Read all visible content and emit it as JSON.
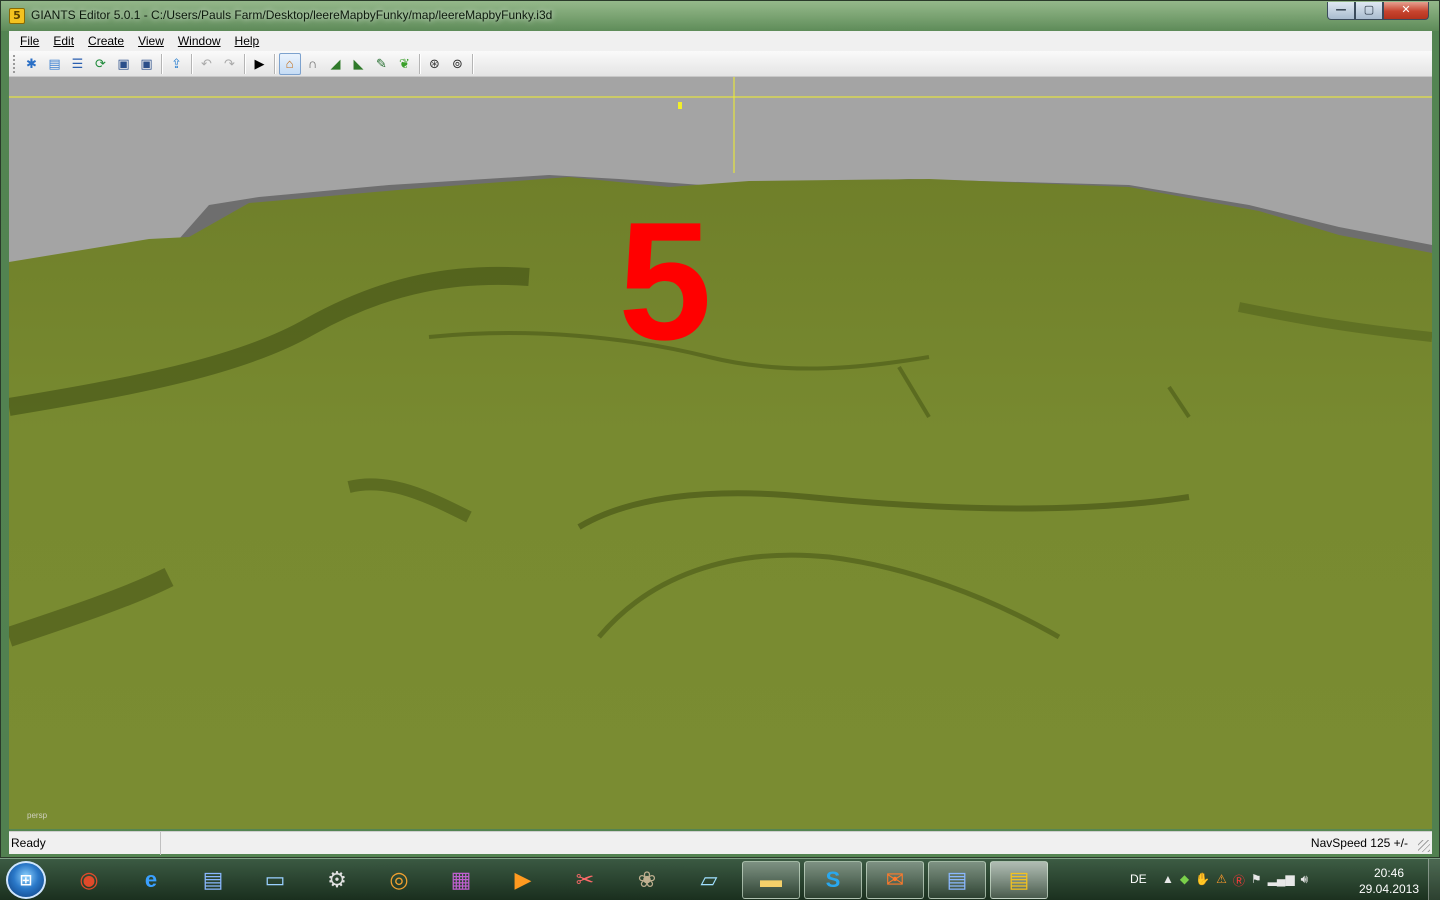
{
  "window": {
    "title": "GIANTS Editor 5.0.1 - C:/Users/Pauls Farm/Desktop/leereMapbyFunky/map/leereMapbyFunky.i3d",
    "app_icon_glyph": "5",
    "controls": {
      "minimize": "—",
      "maximize": "▢",
      "close": "✕"
    }
  },
  "menu": [
    {
      "label": "File"
    },
    {
      "label": "Edit"
    },
    {
      "label": "Create"
    },
    {
      "label": "View"
    },
    {
      "label": "Window"
    },
    {
      "label": "Help"
    }
  ],
  "toolbar": {
    "icons": {
      "new": "new-scene-icon",
      "open": "open-icon",
      "log": "log-icon",
      "reload": "reload-icon",
      "save": "save-icon",
      "save_as": "save-as-icon",
      "export": "export-icon",
      "undo": "undo-icon",
      "redo": "redo-icon",
      "play": "play-icon",
      "select": "select-tool-icon",
      "move": "move-tool-icon",
      "terrain_sculpt": "terrain-sculpt-icon",
      "terrain_paint": "terrain-paint-icon",
      "foliage_paint": "foliage-paint-icon",
      "grass_paint": "grass-paint-icon",
      "debug_a": "debug-render-icon",
      "debug_b": "debug-render-icon-2"
    }
  },
  "viewport": {
    "overlay_number": "5",
    "camera_label": "persp",
    "colors": {
      "sky": "#a4a4a4",
      "terrain_light": "#788a30",
      "terrain_dark": "#4a5818",
      "gizmo": "#f2ef2a",
      "overlay": "#ff0000"
    }
  },
  "status": {
    "left": "Ready",
    "right": "NavSpeed 125 +/-"
  },
  "taskbar": {
    "apps": [
      {
        "name": "chrome",
        "icon": "chrome-icon"
      },
      {
        "name": "internet-explorer",
        "icon": "internet-explorer-icon"
      },
      {
        "name": "giants-editor-pinned",
        "icon": "giants-editor-icon"
      },
      {
        "name": "computer",
        "icon": "computer-icon"
      },
      {
        "name": "settings",
        "icon": "gear-icon"
      },
      {
        "name": "disc-burner",
        "icon": "disc-icon"
      },
      {
        "name": "winrar",
        "icon": "archive-icon"
      },
      {
        "name": "media-player",
        "icon": "media-player-icon"
      },
      {
        "name": "snipping-tool",
        "icon": "scissors-icon"
      },
      {
        "name": "gimp",
        "icon": "gimp-icon"
      },
      {
        "name": "notepad",
        "icon": "notepad-icon"
      },
      {
        "name": "explorer",
        "icon": "folder-icon"
      },
      {
        "name": "skype",
        "icon": "skype-icon"
      },
      {
        "name": "mail",
        "icon": "mail-icon"
      },
      {
        "name": "giants-editor-2",
        "icon": "giants-editor-icon"
      },
      {
        "name": "giants-editor-active",
        "icon": "giants-editor-icon"
      }
    ],
    "language": "DE",
    "clock_time": "20:46",
    "clock_date": "29.04.2013"
  }
}
